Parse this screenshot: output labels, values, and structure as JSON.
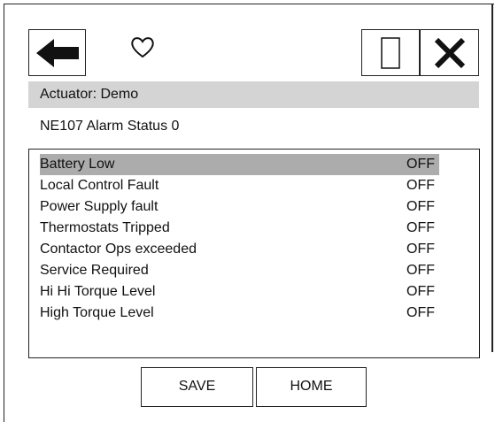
{
  "header": {
    "back_icon": "back-arrow-icon",
    "favorite_icon": "heart-icon",
    "blank_icon": "blank-rectangle-icon",
    "close_icon": "close-x-icon"
  },
  "actuator_label": "Actuator: Demo",
  "status_title": "NE107 Alarm Status 0",
  "alarms": [
    {
      "label": "Battery Low",
      "value": "OFF",
      "selected": true
    },
    {
      "label": "Local Control Fault",
      "value": "OFF"
    },
    {
      "label": "Power Supply fault",
      "value": "OFF"
    },
    {
      "label": "Thermostats Tripped",
      "value": "OFF"
    },
    {
      "label": "Contactor Ops exceeded",
      "value": "OFF"
    },
    {
      "label": "Service Required",
      "value": "OFF"
    },
    {
      "label": "Hi Hi Torque Level",
      "value": "OFF"
    },
    {
      "label": "High Torque Level",
      "value": "OFF"
    }
  ],
  "buttons": {
    "save": "SAVE",
    "home": "HOME"
  },
  "colors": {
    "selected_row": "#acacac",
    "header_bar": "#d4d4d4"
  }
}
